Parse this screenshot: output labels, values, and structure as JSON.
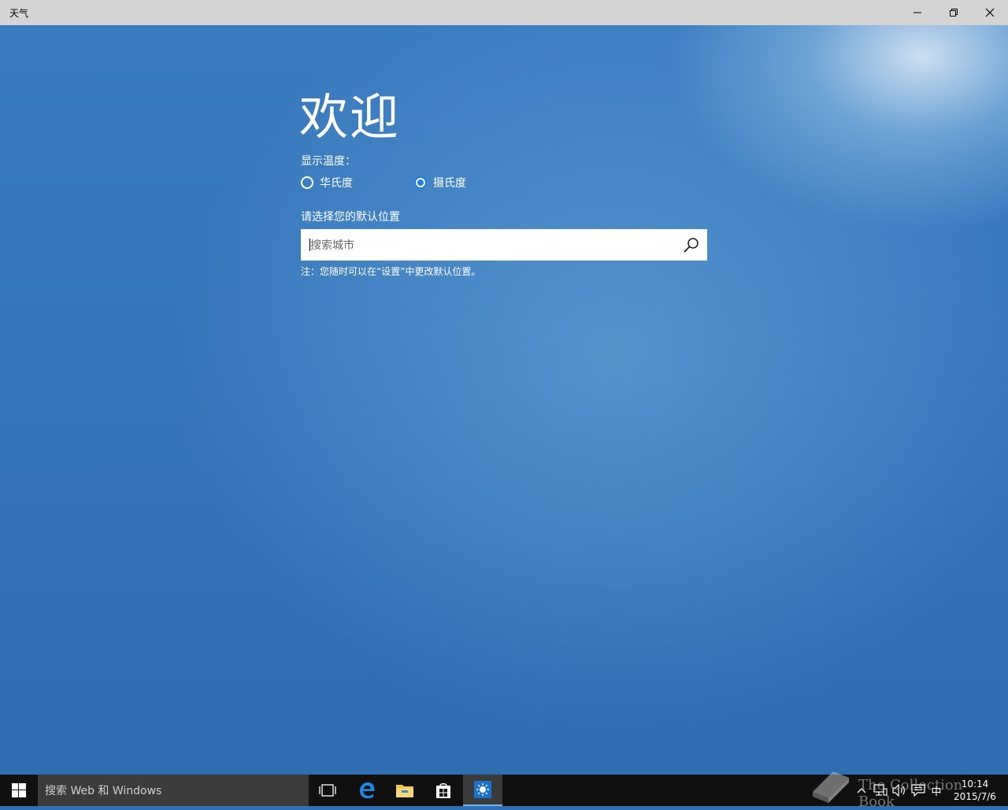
{
  "window": {
    "title": "天气",
    "minimize_icon": "minimize-icon",
    "restore_icon": "restore-icon",
    "close_icon": "close-icon"
  },
  "welcome": {
    "heading": "欢迎",
    "temperature_label": "显示温度：",
    "options": [
      {
        "label": "华氏度",
        "selected": false
      },
      {
        "label": "摄氏度",
        "selected": true
      }
    ],
    "location_label": "请选择您的默认位置",
    "search": {
      "placeholder": "搜索城市",
      "value": ""
    },
    "note": "注：您随时可以在“设置”中更改默认位置。"
  },
  "taskbar": {
    "search_placeholder": "搜索 Web 和 Windows",
    "ime": "中",
    "time": "10:14",
    "date": "2015/7/6"
  },
  "watermark": {
    "text": "The Collection Book"
  },
  "colors": {
    "accent": "#1f7ee0",
    "background": "#2f6fb3",
    "titlebar": "#d4d4d4",
    "taskbar": "#101010"
  }
}
